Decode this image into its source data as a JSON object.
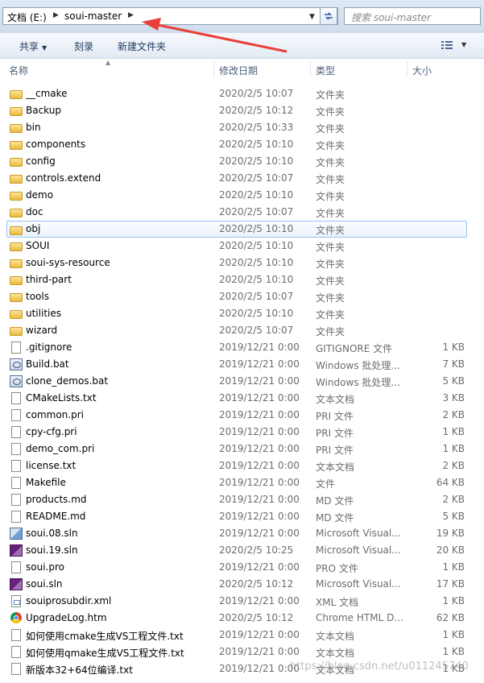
{
  "address": {
    "crumbs": [
      "文档 (E:)",
      "soui-master"
    ],
    "search_placeholder": "搜索 soui-master"
  },
  "toolbar": {
    "share_label": "共享",
    "burn_label": "刻录",
    "new_folder_label": "新建文件夹"
  },
  "columns": {
    "name": "名称",
    "date": "修改日期",
    "type": "类型",
    "size": "大小"
  },
  "files": [
    {
      "name": "__cmake",
      "date": "2020/2/5 10:07",
      "type": "文件夹",
      "size": "",
      "icon": "folder-icon"
    },
    {
      "name": "Backup",
      "date": "2020/2/5 10:12",
      "type": "文件夹",
      "size": "",
      "icon": "folder-icon"
    },
    {
      "name": "bin",
      "date": "2020/2/5 10:33",
      "type": "文件夹",
      "size": "",
      "icon": "folder-icon"
    },
    {
      "name": "components",
      "date": "2020/2/5 10:10",
      "type": "文件夹",
      "size": "",
      "icon": "folder-icon"
    },
    {
      "name": "config",
      "date": "2020/2/5 10:10",
      "type": "文件夹",
      "size": "",
      "icon": "folder-icon"
    },
    {
      "name": "controls.extend",
      "date": "2020/2/5 10:07",
      "type": "文件夹",
      "size": "",
      "icon": "folder-icon"
    },
    {
      "name": "demo",
      "date": "2020/2/5 10:10",
      "type": "文件夹",
      "size": "",
      "icon": "folder-icon"
    },
    {
      "name": "doc",
      "date": "2020/2/5 10:07",
      "type": "文件夹",
      "size": "",
      "icon": "folder-icon"
    },
    {
      "name": "obj",
      "date": "2020/2/5 10:10",
      "type": "文件夹",
      "size": "",
      "icon": "folder-icon",
      "selected": true
    },
    {
      "name": "SOUI",
      "date": "2020/2/5 10:10",
      "type": "文件夹",
      "size": "",
      "icon": "folder-icon"
    },
    {
      "name": "soui-sys-resource",
      "date": "2020/2/5 10:10",
      "type": "文件夹",
      "size": "",
      "icon": "folder-icon"
    },
    {
      "name": "third-part",
      "date": "2020/2/5 10:10",
      "type": "文件夹",
      "size": "",
      "icon": "folder-icon"
    },
    {
      "name": "tools",
      "date": "2020/2/5 10:07",
      "type": "文件夹",
      "size": "",
      "icon": "folder-icon"
    },
    {
      "name": "utilities",
      "date": "2020/2/5 10:10",
      "type": "文件夹",
      "size": "",
      "icon": "folder-icon"
    },
    {
      "name": "wizard",
      "date": "2020/2/5 10:07",
      "type": "文件夹",
      "size": "",
      "icon": "folder-icon"
    },
    {
      "name": ".gitignore",
      "date": "2019/12/21 0:00",
      "type": "GITIGNORE 文件",
      "size": "1 KB",
      "icon": "file-icon"
    },
    {
      "name": "Build.bat",
      "date": "2019/12/21 0:00",
      "type": "Windows 批处理...",
      "size": "7 KB",
      "icon": "batch-file-icon"
    },
    {
      "name": "clone_demos.bat",
      "date": "2019/12/21 0:00",
      "type": "Windows 批处理...",
      "size": "5 KB",
      "icon": "batch-file-icon"
    },
    {
      "name": "CMakeLists.txt",
      "date": "2019/12/21 0:00",
      "type": "文本文档",
      "size": "3 KB",
      "icon": "text-file-icon"
    },
    {
      "name": "common.pri",
      "date": "2019/12/21 0:00",
      "type": "PRI 文件",
      "size": "2 KB",
      "icon": "file-icon"
    },
    {
      "name": "cpy-cfg.pri",
      "date": "2019/12/21 0:00",
      "type": "PRI 文件",
      "size": "1 KB",
      "icon": "file-icon"
    },
    {
      "name": "demo_com.pri",
      "date": "2019/12/21 0:00",
      "type": "PRI 文件",
      "size": "1 KB",
      "icon": "file-icon"
    },
    {
      "name": "license.txt",
      "date": "2019/12/21 0:00",
      "type": "文本文档",
      "size": "2 KB",
      "icon": "text-file-icon"
    },
    {
      "name": "Makefile",
      "date": "2019/12/21 0:00",
      "type": "文件",
      "size": "64 KB",
      "icon": "file-icon"
    },
    {
      "name": "products.md",
      "date": "2019/12/21 0:00",
      "type": "MD 文件",
      "size": "2 KB",
      "icon": "file-icon"
    },
    {
      "name": "README.md",
      "date": "2019/12/21 0:00",
      "type": "MD 文件",
      "size": "5 KB",
      "icon": "file-icon"
    },
    {
      "name": "soui.08.sln",
      "date": "2019/12/21 0:00",
      "type": "Microsoft Visual...",
      "size": "19 KB",
      "icon": "vs2008-solution-icon"
    },
    {
      "name": "soui.19.sln",
      "date": "2020/2/5 10:25",
      "type": "Microsoft Visual...",
      "size": "20 KB",
      "icon": "vs-solution-icon"
    },
    {
      "name": "soui.pro",
      "date": "2019/12/21 0:00",
      "type": "PRO 文件",
      "size": "1 KB",
      "icon": "file-icon"
    },
    {
      "name": "soui.sln",
      "date": "2020/2/5 10:12",
      "type": "Microsoft Visual...",
      "size": "17 KB",
      "icon": "vs-solution-icon"
    },
    {
      "name": "souiprosubdir.xml",
      "date": "2019/12/21 0:00",
      "type": "XML 文档",
      "size": "1 KB",
      "icon": "xml-file-icon"
    },
    {
      "name": "UpgradeLog.htm",
      "date": "2020/2/5 10:12",
      "type": "Chrome HTML D...",
      "size": "62 KB",
      "icon": "chrome-icon"
    },
    {
      "name": "如何使用cmake生成VS工程文件.txt",
      "date": "2019/12/21 0:00",
      "type": "文本文档",
      "size": "1 KB",
      "icon": "text-file-icon"
    },
    {
      "name": "如何使用qmake生成VS工程文件.txt",
      "date": "2019/12/21 0:00",
      "type": "文本文档",
      "size": "1 KB",
      "icon": "text-file-icon"
    },
    {
      "name": "新版本32+64位编译.txt",
      "date": "2019/12/21 0:00",
      "type": "文本文档",
      "size": "1 KB",
      "icon": "text-file-icon"
    }
  ],
  "watermark": "https://blog.csdn.net/u011245740",
  "colors": {
    "annotation_arrow": "#e8413b",
    "selection_border": "#99c3ea",
    "header_text": "#4c607a"
  }
}
